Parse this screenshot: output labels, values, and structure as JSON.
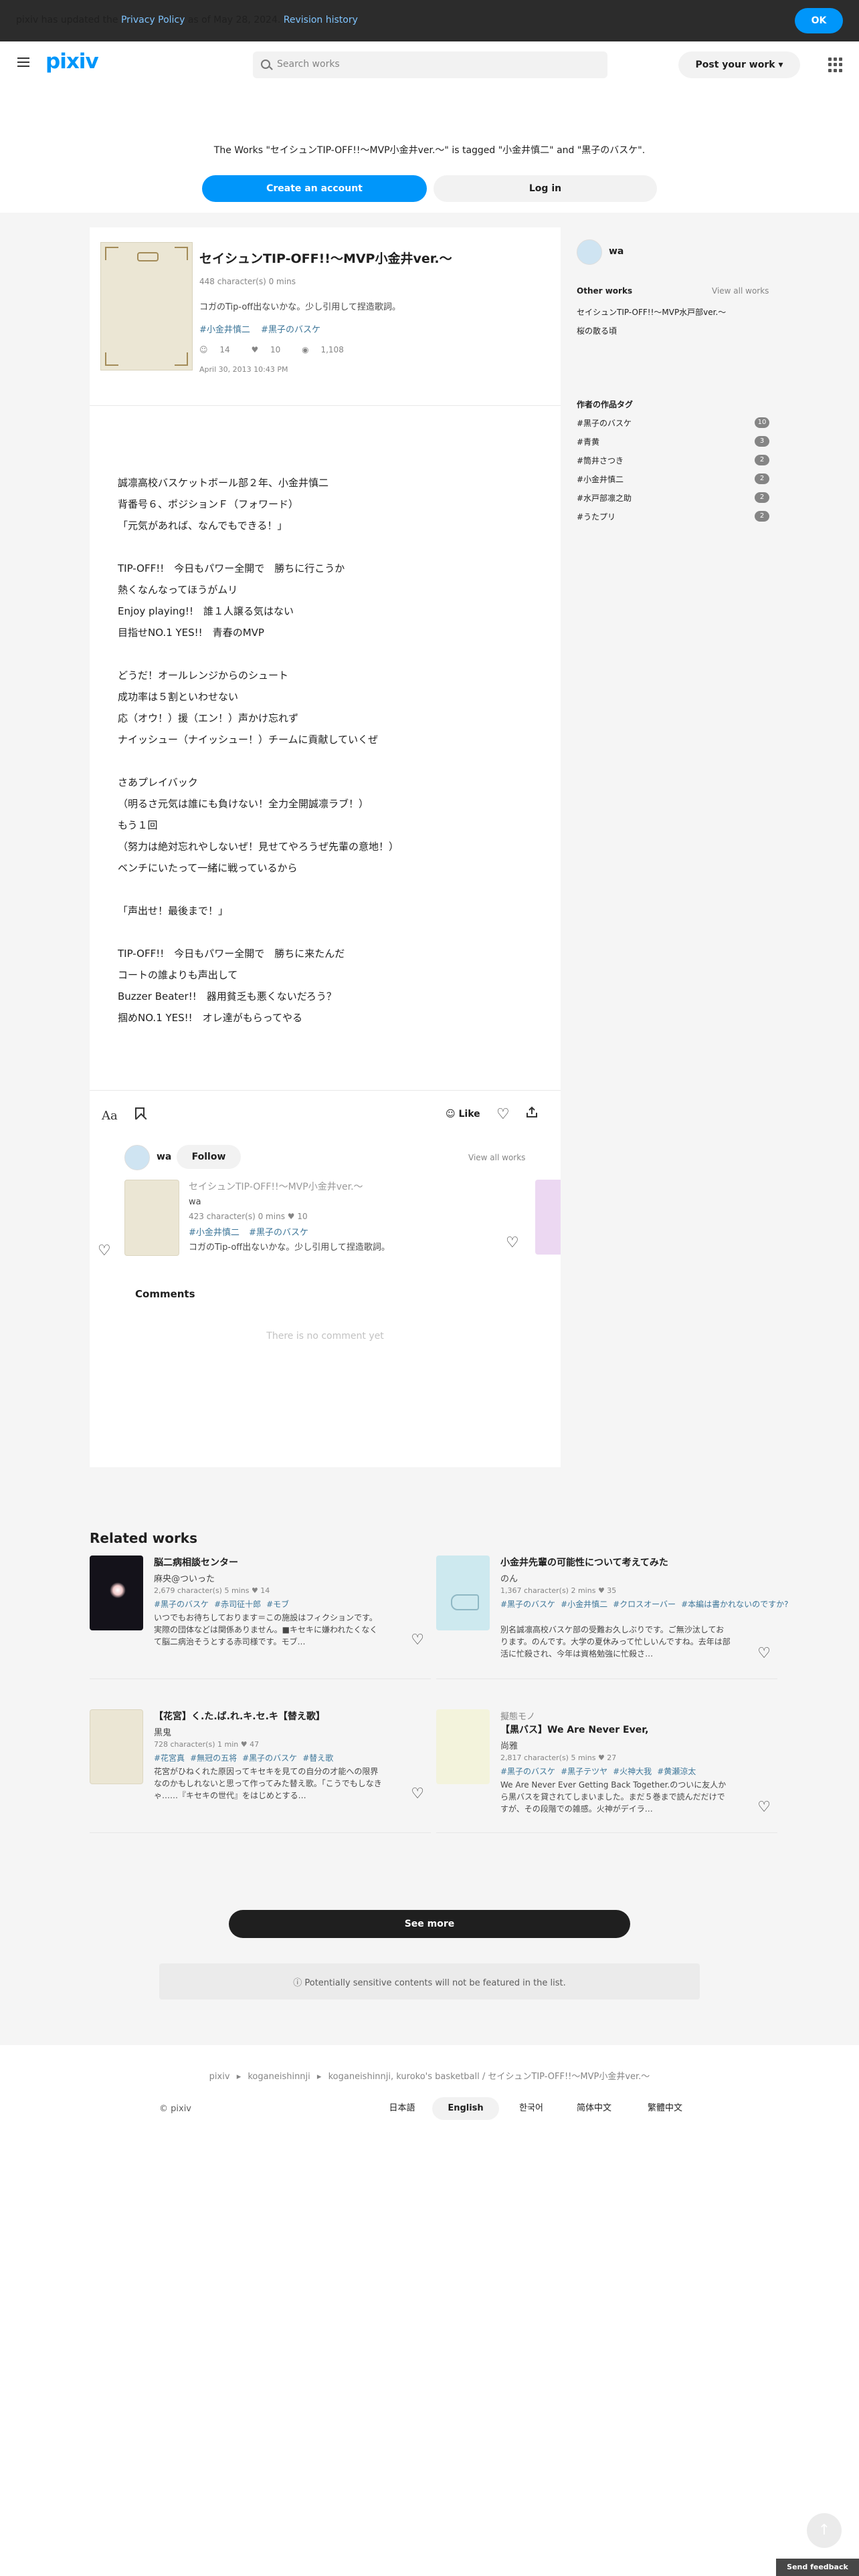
{
  "privacy": {
    "prefix": "pixiv has updated the ",
    "link": "Privacy Policy",
    "middle": " as of May 28, 2024. ",
    "history": "Revision history",
    "ok": "OK"
  },
  "header": {
    "logo": "pixiv",
    "search_placeholder": "Search works",
    "post_button": "Post your work",
    "post_chevron": "▾"
  },
  "tag_notice": {
    "text": "The Works \"セイシュンTIP-OFF!!〜MVP小金井ver.〜\" is tagged \"小金井慎二\" and \"黒子のバスケ\".",
    "create_account": "Create an account",
    "log_in": "Log in"
  },
  "work": {
    "title": "セイシュンTIP-OFF!!〜MVP小金井ver.〜",
    "meta": "448 character(s)  0 mins",
    "caption": "コガのTip-off出ないかな。少し引用して捏造歌詞。",
    "tags": [
      "#小金井慎二",
      "#黒子のバスケ"
    ],
    "likes": "14",
    "bookmarks": "10",
    "views": "1,108",
    "date": "April 30, 2013 10:43 PM",
    "body": "誠凛高校バスケットボール部２年、小金井慎二\n背番号６、ポジションＦ（フォワード）\n「元気があれば、なんでもできる！」\n\nTIP-OFF!!　今日もパワー全開で　勝ちに行こうか\n熱くなんなってほうがムリ\nEnjoy playing!!　誰１人譲る気はない\n目指せNO.1 YES!!　青春のMVP\n\nどうだ！オールレンジからのシュート\n成功率は５割といわせない\n応（オウ！）援（エン！）声かけ忘れず\nナイッシュー（ナイッシュー！）チームに貢献していくぜ\n\nさあプレイバック\n（明るさ元気は誰にも負けない！全力全開誠凛ラブ！）\nもう１回\n（努力は絶対忘れやしないぜ！見せてやろうぜ先輩の意地！）\nベンチにいたって一緒に戦っているから\n\n「声出せ！最後まで！」\n\nTIP-OFF!!　今日もパワー全開で　勝ちに来たんだ\nコートの誰よりも声出して\nBuzzer Beater!!　器用貧乏も悪くないだろう？\n掴めNO.1 YES!!　オレ達がもらってやる"
  },
  "toolbar": {
    "font_icon_label": "Aa",
    "like_label": "Like"
  },
  "author": {
    "name": "wa",
    "follow": "Follow",
    "view_all": "View all works"
  },
  "series_card": {
    "title": "セイシュンTIP-OFF!!〜MVP小金井ver.〜",
    "author": "wa",
    "meta": "423 character(s)  0 mins  ♥ 10",
    "tags": [
      "#小金井慎二",
      "#黒子のバスケ"
    ],
    "caption": "コガのTip-off出ないかな。少し引用して捏造歌詞。"
  },
  "comments": {
    "title": "Comments",
    "empty": "There is no comment yet"
  },
  "sidebar": {
    "name": "wa",
    "other_works": "Other works",
    "view_all": "View all works",
    "works": [
      "セイシュンTIP-OFF!!〜MVP水戸部ver.〜",
      "桜の散る頃"
    ],
    "tags_title": "作者の作品タグ",
    "tags": [
      {
        "name": "#黒子のバスケ",
        "count": "10"
      },
      {
        "name": "#青黄",
        "count": "3"
      },
      {
        "name": "#筒井さつき",
        "count": "2"
      },
      {
        "name": "#小金井慎二",
        "count": "2"
      },
      {
        "name": "#水戸部凛之助",
        "count": "2"
      },
      {
        "name": "#うたプリ",
        "count": "2"
      }
    ]
  },
  "related": {
    "title": "Related works",
    "items": [
      {
        "series": "",
        "title": "脳二病相談センター",
        "author": "麻央@ついった",
        "meta": "2,679 character(s)  5 mins  ♥ 14",
        "tags": [
          "#黒子のバスケ",
          "#赤司征十郎",
          "#モブ"
        ],
        "caption": "いつでもお待ちしております＝この施設はフィクションです。実際の団体などは関係ありません。■キセキに嫌われたくなくて脳二病治そうとする赤司様です。モブ…",
        "thumb_color": "#14121a"
      },
      {
        "series": "",
        "title": "小金井先輩の可能性について考えてみた",
        "author": "のん",
        "meta": "1,367 character(s)  2 mins  ♥ 35",
        "tags": [
          "#黒子のバスケ",
          "#小金井慎二",
          "#クロスオーバー",
          "#本編は書かれないのですか?"
        ],
        "caption": "別名誠凛高校バスケ部の受難お久しぶりです。ご無沙汰しております。のんです。大学の夏休みって忙しいんですね。去年は部活に忙殺され、今年は資格勉強に忙殺さ…",
        "thumb_color": "#cde9ef"
      },
      {
        "series": "",
        "title": "【花宮】く.た.ば.れ.キ.セ.キ【替え歌】",
        "author": "黒鬼",
        "meta": "728 character(s)  1 min  ♥ 47",
        "tags": [
          "#花宮真",
          "#無冠の五将",
          "#黒子のバスケ",
          "#替え歌"
        ],
        "caption": "花宮がひねくれた原因ってキセキを見ての自分の才能への限界なのかもしれないと思って作ってみた替え歌。「こうでもしなきゃ……『キセキの世代』をはじめとする…",
        "thumb_color": "#ebe6d4"
      },
      {
        "series": "擬態モノ",
        "title": "【黒バス】We Are Never Ever,",
        "author": "尚雅",
        "meta": "2,817 character(s)  5 mins  ♥ 27",
        "tags": [
          "#黒子のバスケ",
          "#黒子テツヤ",
          "#火神大我",
          "#黄瀬涼太"
        ],
        "caption": "We Are Never Ever Getting Back Together.のついに友人から黒バスを貸されてしまいました。まだ５巻まで読んだだけですが、その段階での雑感。火神がデイラ…",
        "thumb_color": "#f3f3dc"
      }
    ]
  },
  "see_more": "See more",
  "sensitive_notice": "Potentially sensitive contents will not be featured in the list.",
  "footer": {
    "breadcrumb": [
      "pixiv",
      "koganeishinnji",
      "koganeishinnji, kuroko's basketball / セイシュンTIP-OFF!!〜MVP小金井ver.〜"
    ],
    "separator": "▸",
    "copyright": "© pixiv",
    "languages": [
      "日本語",
      "English",
      "한국어",
      "简体中文",
      "繁體中文"
    ],
    "active_language": "English"
  },
  "feedback": "Send feedback",
  "colors": {
    "brand": "#0096fa",
    "tag_link": "#3d7699",
    "privacy_bar": "#2c2c2c"
  }
}
